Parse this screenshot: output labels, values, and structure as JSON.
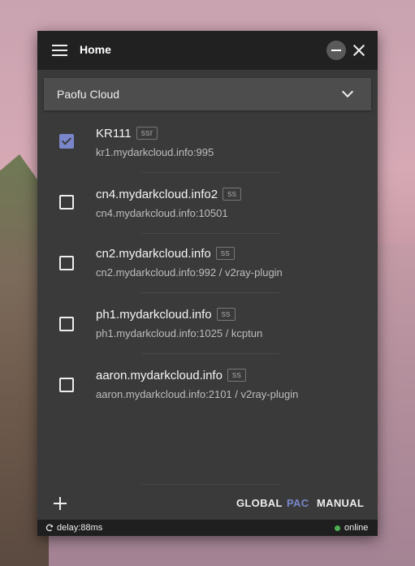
{
  "window": {
    "title": "Home"
  },
  "group": {
    "selected": "Paofu Cloud"
  },
  "servers": [
    {
      "name": "KR111",
      "type": "ssr",
      "address": "kr1.mydarkcloud.info:995",
      "checked": true
    },
    {
      "name": "cn4.mydarkcloud.info2",
      "type": "ss",
      "address": "cn4.mydarkcloud.info:10501",
      "checked": false
    },
    {
      "name": "cn2.mydarkcloud.info",
      "type": "ss",
      "address": "cn2.mydarkcloud.info:992 / v2ray-plugin",
      "checked": false
    },
    {
      "name": "ph1.mydarkcloud.info",
      "type": "ss",
      "address": "ph1.mydarkcloud.info:1025 / kcptun",
      "checked": false
    },
    {
      "name": "aaron.mydarkcloud.info",
      "type": "ss",
      "address": "aaron.mydarkcloud.info:2101 / v2ray-plugin",
      "checked": false
    }
  ],
  "modes": {
    "global": "GLOBAL",
    "pac": "PAC",
    "manual": "MANUAL",
    "active": "PAC"
  },
  "status": {
    "delay": "delay:88ms",
    "connection": "online"
  },
  "colors": {
    "accent": "#7986cb",
    "online": "#4caf50",
    "titlebar": "#212121",
    "window_bg": "#3a3a3a"
  },
  "icons": {
    "menu": "menu-icon",
    "minimize": "minimize-icon",
    "close": "close-icon",
    "dropdown": "chevron-down-icon",
    "add": "add-icon",
    "refresh": "refresh-icon"
  }
}
